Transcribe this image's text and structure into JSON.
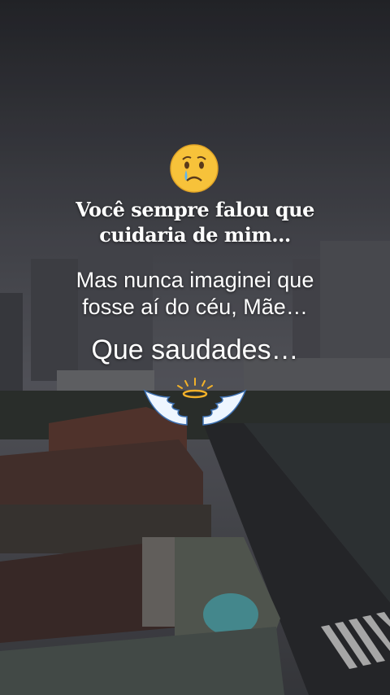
{
  "scene": {
    "description_icon": "rainy-cityscape-photo"
  },
  "emoji": {
    "icon": "sad-face-emoji"
  },
  "text": {
    "line1": "Você sempre falou que cuidaria de mim…",
    "line2": "Mas nunca imaginei que fosse aí do céu, Mãe…",
    "line3": "Que saudades…"
  },
  "sticker": {
    "icon": "angel-wings-halo-icon"
  }
}
